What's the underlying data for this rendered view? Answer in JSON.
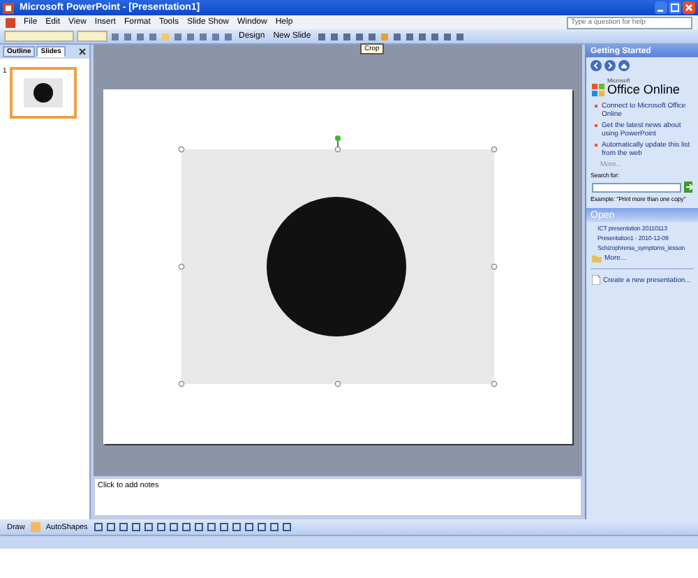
{
  "window": {
    "title": "Microsoft PowerPoint - [Presentation1]"
  },
  "menu": [
    "File",
    "Edit",
    "View",
    "Insert",
    "Format",
    "Tools",
    "Slide Show",
    "Window",
    "Help"
  ],
  "help_search": {
    "placeholder": "Type a question for help"
  },
  "toolbar": {
    "design_button": "Design",
    "new_slide_button": "New Slide",
    "tooltip": "Crop"
  },
  "left_pane": {
    "tabs": [
      {
        "label": "Outline",
        "selected": false
      },
      {
        "label": "Slides",
        "selected": true
      }
    ],
    "slides": [
      {
        "number": "1",
        "selected": true
      }
    ]
  },
  "notes": {
    "placeholder": "Click to add notes"
  },
  "task_pane": {
    "title": "Getting Started",
    "brand_small": "Microsoft",
    "brand": "Office Online",
    "links": [
      "Connect to Microsoft Office Online",
      "Get the latest news about using PowerPoint",
      "Automatically update this list from the web"
    ],
    "more": "More...",
    "search_label": "Search for:",
    "example": "Example:  \"Print more than one copy\"",
    "open_heading": "Open",
    "recent_files": [
      "ICT presentation 20110113",
      "Presentation1 - 2010-12-09",
      "Schizophrenia_symptoms_lesson"
    ],
    "more_files": "More...",
    "create": "Create a new presentation..."
  },
  "drawing_toolbar": {
    "draw": "Draw",
    "autoshapes": "AutoShapes"
  }
}
